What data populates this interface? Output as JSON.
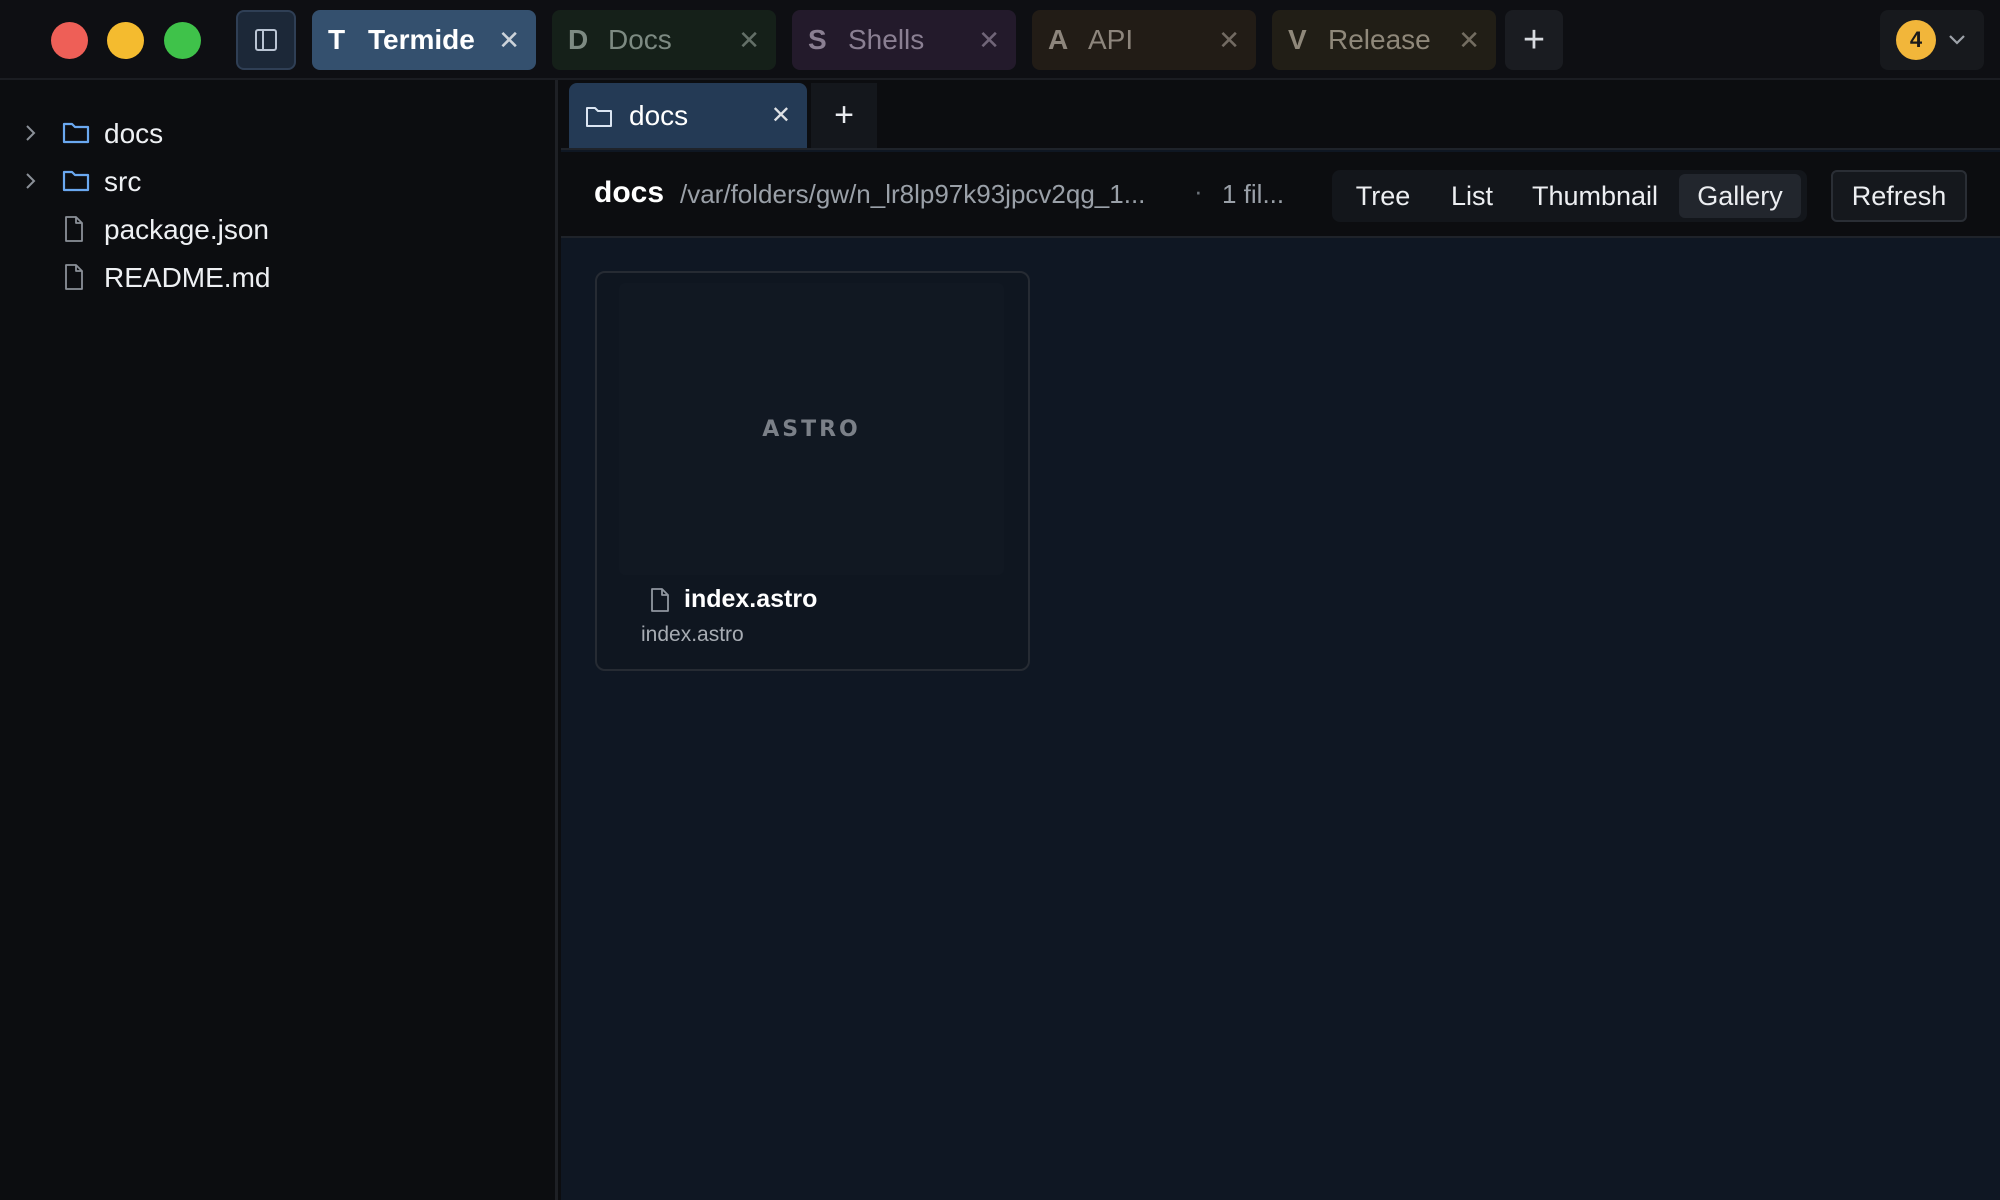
{
  "window": {
    "traffic_lights": [
      "close",
      "minimize",
      "zoom"
    ]
  },
  "window_tabs": [
    {
      "letter": "T",
      "label": "Termide",
      "active": true,
      "color": "#34506e"
    },
    {
      "letter": "D",
      "label": "Docs",
      "active": false,
      "color": "#152019"
    },
    {
      "letter": "S",
      "label": "Shells",
      "active": false,
      "color": "#231a2b"
    },
    {
      "letter": "A",
      "label": "API",
      "active": false,
      "color": "#221c16"
    },
    {
      "letter": "V",
      "label": "Release",
      "active": false,
      "color": "#211e16"
    }
  ],
  "tab_close_glyph": "✕",
  "add_glyph": "+",
  "notifications": {
    "count": "4",
    "color": "#f2b63a"
  },
  "explorer": {
    "items": [
      {
        "label": "docs",
        "type": "folder",
        "expandable": true
      },
      {
        "label": "src",
        "type": "folder",
        "expandable": true
      },
      {
        "label": "package.json",
        "type": "file",
        "expandable": false
      },
      {
        "label": "README.md",
        "type": "file",
        "expandable": false
      }
    ]
  },
  "panel": {
    "tab": {
      "label": "docs",
      "icon": "folder-icon"
    },
    "toolbar": {
      "title": "docs",
      "path": "/var/folders/gw/n_lr8lp97k93jpcv2qg_1...",
      "separator": "·",
      "count": "1 fil...",
      "views": [
        "Tree",
        "List",
        "Thumbnail",
        "Gallery"
      ],
      "active_view": "Gallery",
      "refresh_label": "Refresh"
    },
    "gallery": [
      {
        "thumb_label": "ASTRO",
        "name": "index.astro",
        "subtitle": "index.astro"
      }
    ]
  },
  "colors": {
    "accent_folder": "#6aa8f0",
    "background": "#0f1723"
  }
}
